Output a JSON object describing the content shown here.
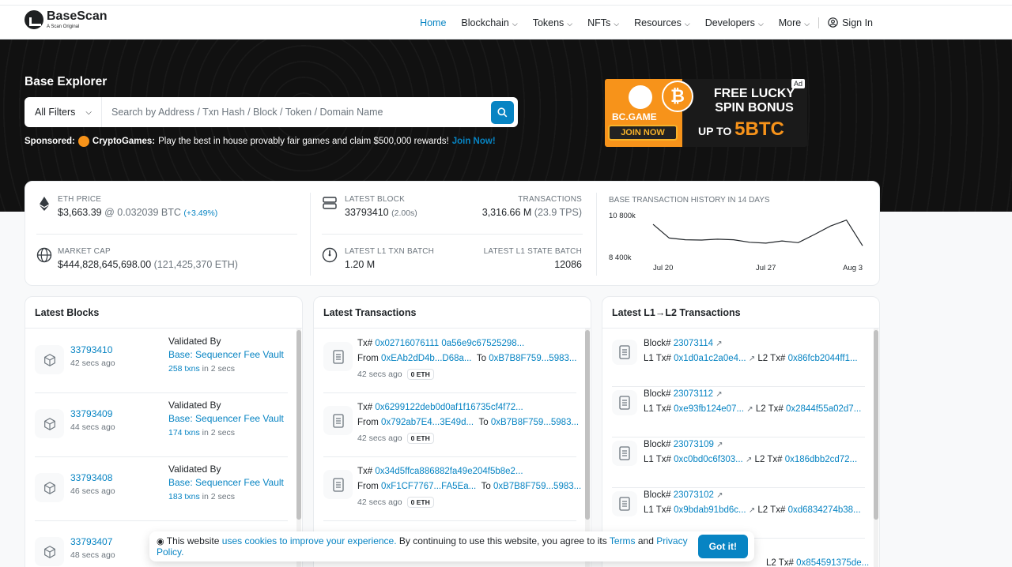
{
  "header": {
    "logo_name": "BaseScan",
    "logo_tag": "A Scan Original",
    "nav": [
      {
        "label": "Home"
      },
      {
        "label": "Blockchain"
      },
      {
        "label": "Tokens"
      },
      {
        "label": "NFTs"
      },
      {
        "label": "Resources"
      },
      {
        "label": "Developers"
      },
      {
        "label": "More"
      }
    ],
    "sign_in": "Sign In"
  },
  "hero": {
    "title": "Base Explorer",
    "filter_label": "All Filters",
    "search_placeholder": "Search by Address / Txn Hash / Block / Token / Domain Name",
    "sponsored_label": "Sponsored:",
    "sponsor_name": "CryptoGames:",
    "sponsor_text": "Play the best in house provably fair games and claim $500,000 rewards!",
    "sponsor_link": "Join Now!"
  },
  "ad": {
    "badge": "Ad",
    "brand": "BC.GAME",
    "join": "JOIN NOW",
    "line1": "FREE LUCKY SPIN BONUS",
    "upto": "UP TO",
    "amount": "5BTC"
  },
  "stats": {
    "eth_price_label": "ETH PRICE",
    "eth_price_value": "$3,663.39",
    "eth_price_btc": "@ 0.032039 BTC",
    "eth_price_change": "(+3.49%)",
    "market_cap_label": "MARKET CAP",
    "market_cap_value": "$444,828,645,698.00",
    "market_cap_eth": "(121,425,370 ETH)",
    "latest_block_label": "LATEST BLOCK",
    "latest_block_value": "33793410",
    "latest_block_time": "(2.00s)",
    "transactions_label": "TRANSACTIONS",
    "transactions_value": "3,316.66 M",
    "transactions_tps": "(23.9 TPS)",
    "l1_txn_batch_label": "LATEST L1 TXN BATCH",
    "l1_txn_batch_value": "1.20 M",
    "l1_state_batch_label": "LATEST L1 STATE BATCH",
    "l1_state_batch_value": "12086"
  },
  "chart_data": {
    "type": "line",
    "title": "BASE TRANSACTION HISTORY IN 14 DAYS",
    "x_tick_labels": [
      "Jul 20",
      "Jul 27",
      "Aug 3"
    ],
    "y_tick_labels": [
      "10 800k",
      "8 400k"
    ],
    "ylim": [
      8400000,
      10800000
    ],
    "series": [
      {
        "values": [
          10150000,
          9350000,
          9250000,
          9230000,
          9280000,
          9250000,
          9100000,
          9050000,
          9180000,
          9080000,
          9550000,
          10050000,
          10400000,
          8900000
        ]
      }
    ],
    "color": "#212529"
  },
  "latest_blocks": {
    "title": "Latest Blocks",
    "items": [
      {
        "number": "33793410",
        "time": "42 secs ago",
        "validated_by": "Validated By",
        "validator": "Base: Sequencer Fee Vault",
        "txns": "258 txns",
        "txns_time": "in 2 secs"
      },
      {
        "number": "33793409",
        "time": "44 secs ago",
        "validated_by": "Validated By",
        "validator": "Base: Sequencer Fee Vault",
        "txns": "174 txns",
        "txns_time": "in 2 secs"
      },
      {
        "number": "33793408",
        "time": "46 secs ago",
        "validated_by": "Validated By",
        "validator": "Base: Sequencer Fee Vault",
        "txns": "183 txns",
        "txns_time": "in 2 secs"
      },
      {
        "number": "33793407",
        "time": "48 secs ago",
        "validated_by": "",
        "validator": "",
        "txns": "",
        "txns_time": ""
      }
    ]
  },
  "latest_transactions": {
    "title": "Latest Transactions",
    "items": [
      {
        "tx_label": "Tx#",
        "hash": "0x02716076111 0a56e9c67525298...",
        "from_label": "From",
        "from": "0xEAb2dD4b...D68a...",
        "to_label": "To",
        "to": "0xB7B8F759...5983...",
        "time": "42 secs ago",
        "value": "0 ETH"
      },
      {
        "tx_label": "Tx#",
        "hash": "0x6299122deb0d0af1f16735cf4f72...",
        "from_label": "From",
        "from": "0x792ab7E4...3E49d...",
        "to_label": "To",
        "to": "0xB7B8F759...5983...",
        "time": "42 secs ago",
        "value": "0 ETH"
      },
      {
        "tx_label": "Tx#",
        "hash": "0x34d5ffca886882fa49e204f5b8e2...",
        "from_label": "From",
        "from": "0xF1CF7767...FA5Ea...",
        "to_label": "To",
        "to": "0xB7B8F759...5983...",
        "time": "42 secs ago",
        "value": "0 ETH"
      }
    ]
  },
  "l1_l2_transactions": {
    "title": "Latest L1→L2 Transactions",
    "items": [
      {
        "block_label": "Block#",
        "block": "23073114",
        "l1_label": "L1 Tx#",
        "l1": "0x1d0a1c2a0e4...",
        "l2_label": "L2 Tx#",
        "l2": "0x86fcb2044ff1..."
      },
      {
        "block_label": "Block#",
        "block": "23073112",
        "l1_label": "L1 Tx#",
        "l1": "0xe93fb124e07...",
        "l2_label": "L2 Tx#",
        "l2": "0x2844f55a02d7..."
      },
      {
        "block_label": "Block#",
        "block": "23073109",
        "l1_label": "L1 Tx#",
        "l1": "0xc0bd0c6f303...",
        "l2_label": "L2 Tx#",
        "l2": "0x186dbb2cd72..."
      },
      {
        "block_label": "Block#",
        "block": "23073102",
        "l1_label": "L1 Tx#",
        "l1": "0x9bdab91bd6c...",
        "l2_label": "L2 Tx#",
        "l2": "0xd6834274b38..."
      },
      {
        "block_label": "",
        "block": "",
        "l1_label": "",
        "l1": "",
        "l2_label": "L2 Tx#",
        "l2": "0x854591375de..."
      }
    ]
  },
  "cookie": {
    "text_before": "This website",
    "link1": "uses cookies to improve your experience.",
    "text_mid": "By continuing to use this website, you agree to its",
    "link2": "Terms",
    "and": "and",
    "link3": "Privacy Policy.",
    "button": "Got it!"
  }
}
